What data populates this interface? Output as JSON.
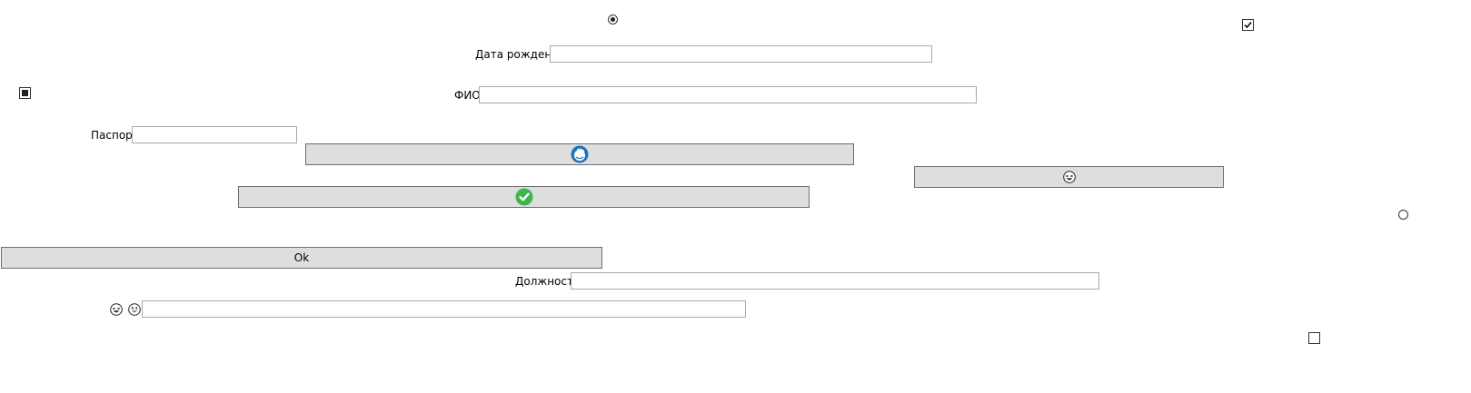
{
  "form": {
    "birth_date_label": "Дата рождения",
    "birth_date_value": "",
    "full_name_label": "ФИО",
    "full_name_value": "",
    "passport_label": "Паспорт",
    "passport_value": "",
    "position_label": "Должность",
    "position_value": "",
    "emoji_field_value": ""
  },
  "buttons": {
    "ok_label": "Ok",
    "hand_button_icon": "waving-hand-icon",
    "check_button_icon": "green-check-icon",
    "laugh_button_icon": "laughing-emoji-icon"
  },
  "controls": {
    "radio_top": {
      "checked": true
    },
    "radio_right": {
      "checked": false
    },
    "checkbox_top_right": {
      "state": "checked"
    },
    "checkbox_left": {
      "state": "indeterminate"
    },
    "checkbox_bottom_right": {
      "state": "unchecked"
    }
  },
  "colors": {
    "button_bg": "#dedede",
    "check_green": "#3fb54a",
    "hand_blue": "#1e73be"
  }
}
